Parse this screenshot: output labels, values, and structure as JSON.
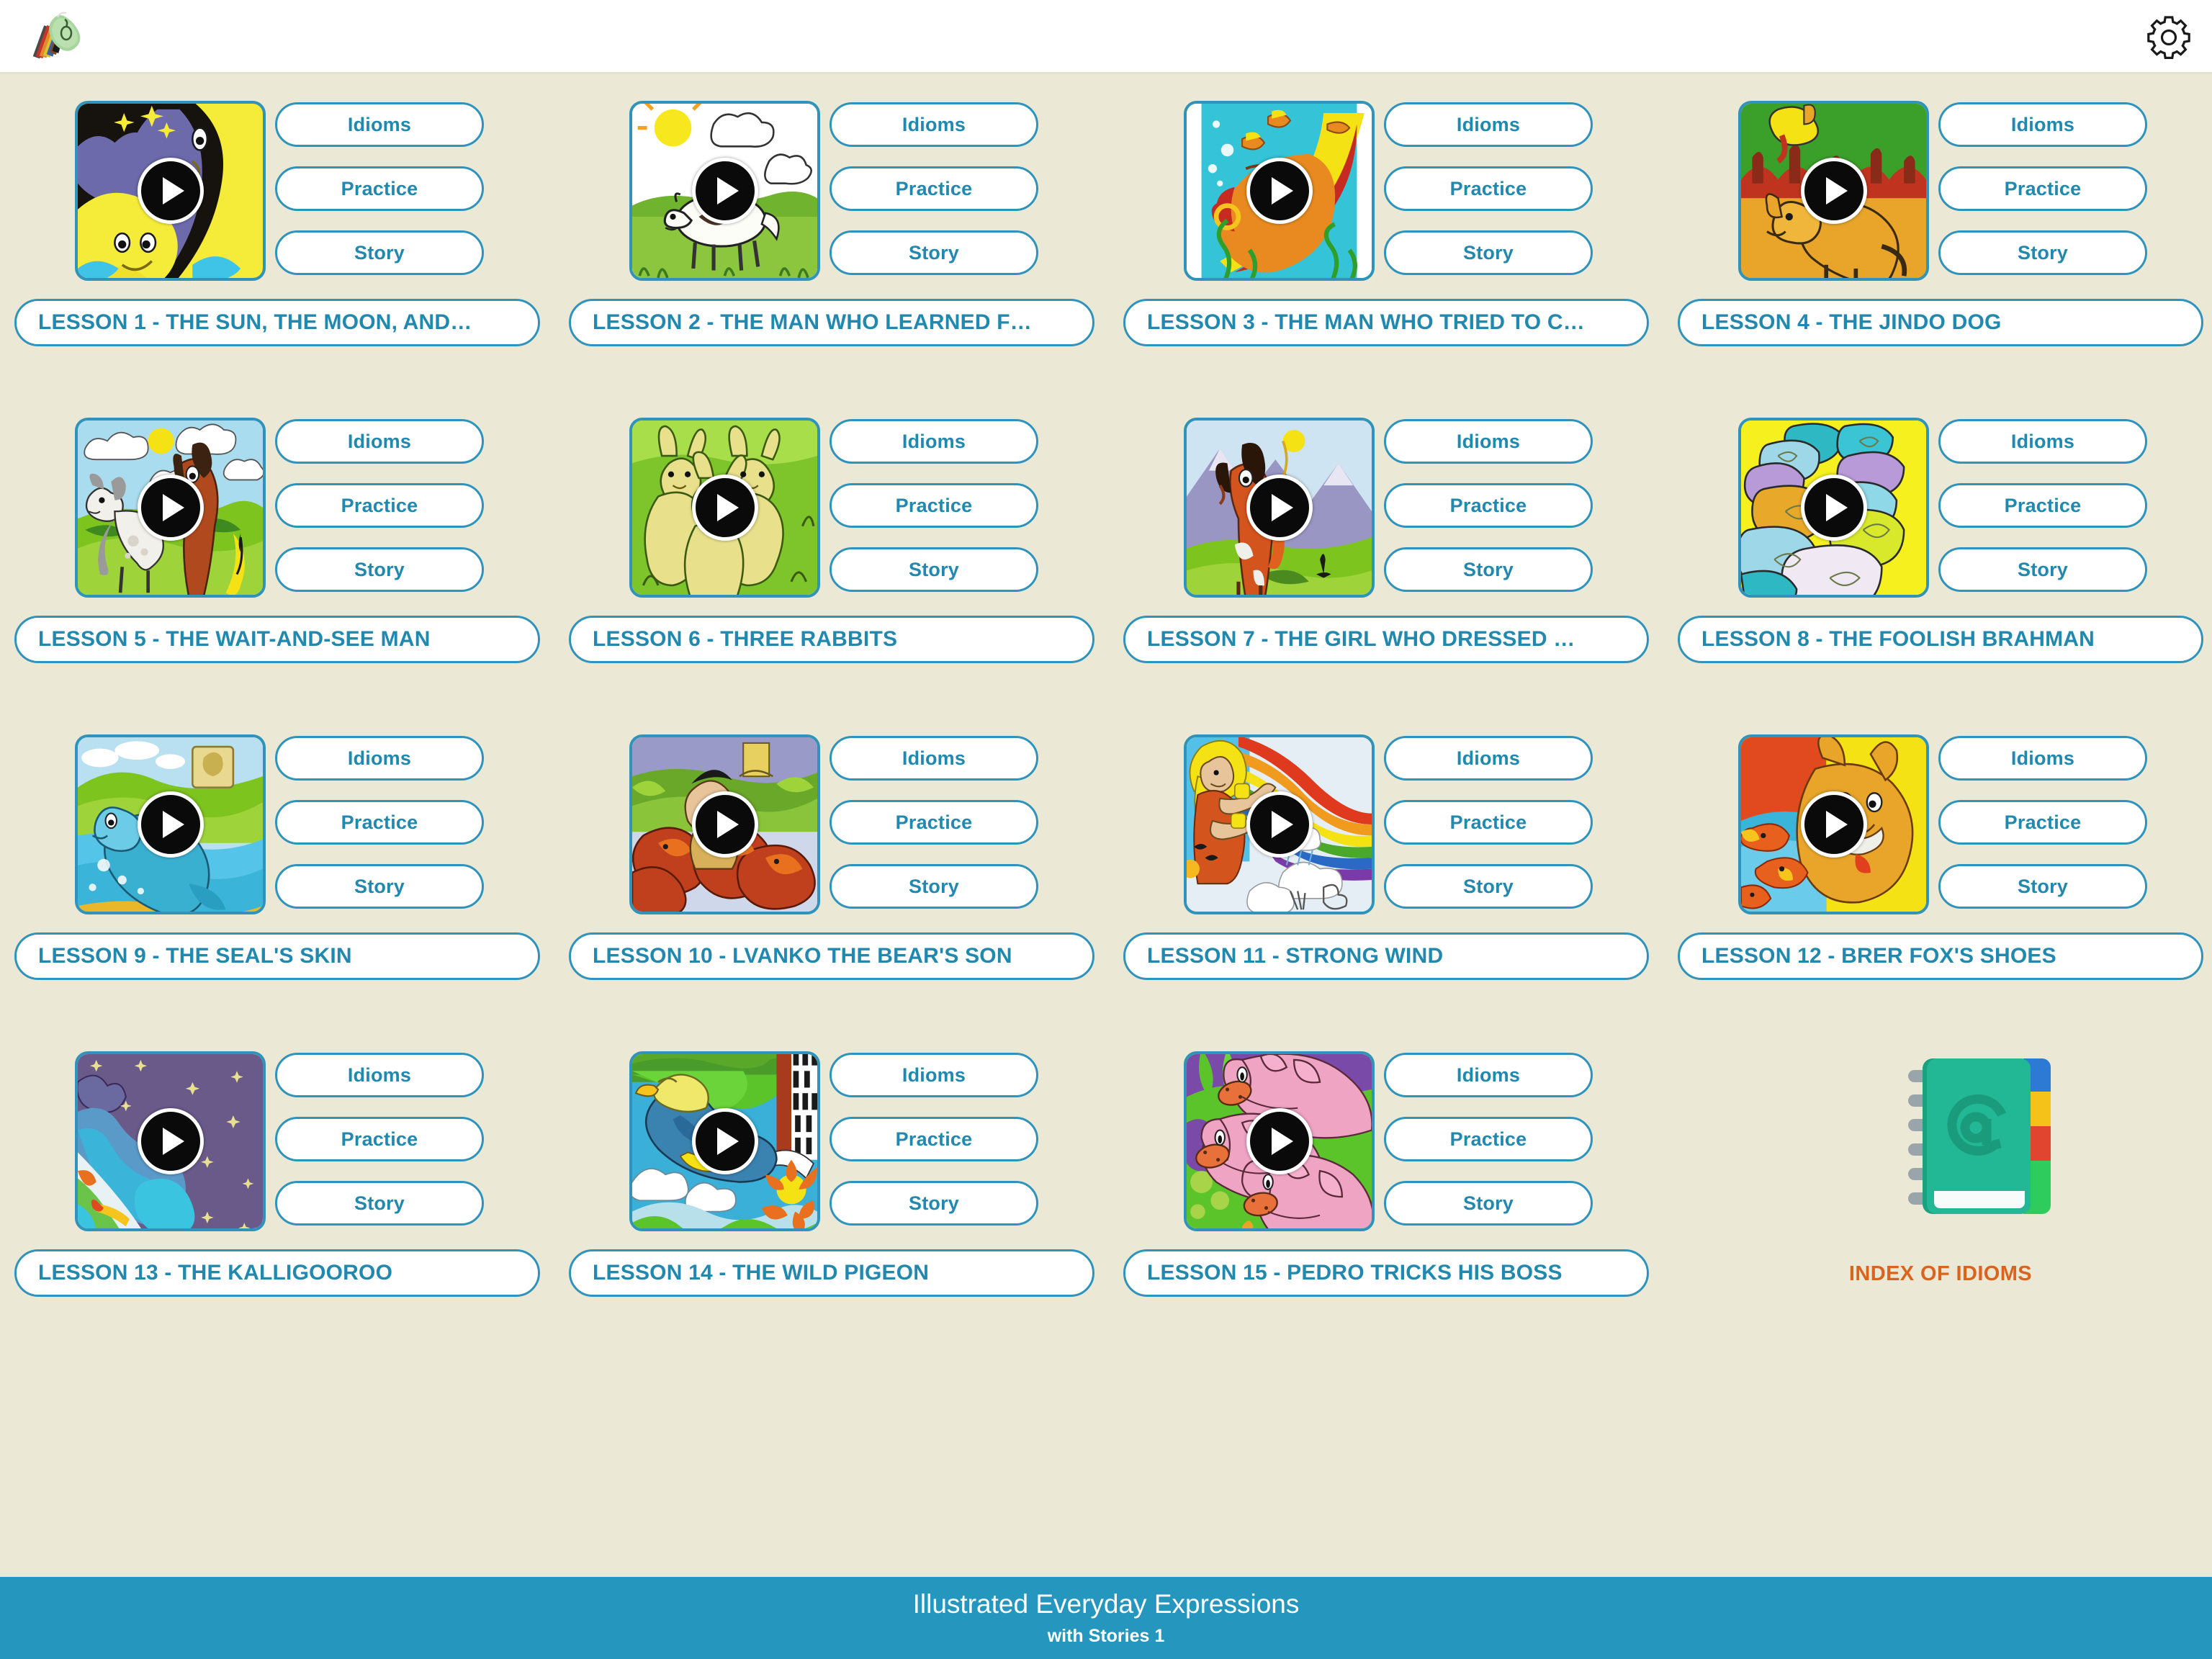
{
  "app": {
    "logo_icon": "color-swatch-fan-icon",
    "settings_icon": "gear-icon"
  },
  "buttons": {
    "idioms": "Idioms",
    "practice": "Practice",
    "story": "Story",
    "play_icon": "play-icon"
  },
  "index_tile": {
    "label": "INDEX OF IDIOMS",
    "icon": "address-book-at-icon"
  },
  "footer": {
    "line1": "Illustrated Everyday Expressions",
    "line2": "with Stories 1"
  },
  "colors": {
    "page_background": "#ebe9d6",
    "topbar_background": "#ffffff",
    "accent_teal": "#2f93bb",
    "text_teal": "#2189b0",
    "footer_teal": "#2596be",
    "index_orange": "#d9641e"
  },
  "lessons": [
    {
      "title": "LESSON 1 - THE SUN, THE MOON, AND…",
      "thumb": "sun-and-moon-night-sky"
    },
    {
      "title": "LESSON 2 - THE MAN WHO LEARNED F…",
      "thumb": "cow-in-meadow-with-sun"
    },
    {
      "title": "LESSON 3 - THE MAN WHO TRIED TO C…",
      "thumb": "big-fish-underwater-with-ring"
    },
    {
      "title": "LESSON 4 - THE JINDO DOG",
      "thumb": "dog-on-green-hill"
    },
    {
      "title": "LESSON 5 - THE WAIT-AND-SEE MAN",
      "thumb": "two-horses-in-field"
    },
    {
      "title": "LESSON 6 - THREE RABBITS",
      "thumb": "three-green-rabbits"
    },
    {
      "title": "LESSON 7 - THE GIRL WHO DRESSED …",
      "thumb": "horse-in-mountains"
    },
    {
      "title": "LESSON 8 - THE FOOLISH BRAHMAN",
      "thumb": "colorful-clay-pots"
    },
    {
      "title": "LESSON 9 - THE SEAL'S SKIN",
      "thumb": "seal-in-water"
    },
    {
      "title": "LESSON 10 - LVANKO THE BEAR'S SON",
      "thumb": "bear-son-scene"
    },
    {
      "title": "LESSON 11 - STRONG WIND",
      "thumb": "girl-holding-rainbow"
    },
    {
      "title": "LESSON 12 - BRER FOX'S SHOES",
      "thumb": "fox-and-fish-bowl"
    },
    {
      "title": "LESSON 13 - THE KALLIGOOROO",
      "thumb": "purple-starry-night-map"
    },
    {
      "title": "LESSON 14 - THE WILD PIGEON",
      "thumb": "blue-bird-with-piano"
    },
    {
      "title": "LESSON 15 - PEDRO TRICKS HIS BOSS",
      "thumb": "three-pink-pigs"
    }
  ]
}
